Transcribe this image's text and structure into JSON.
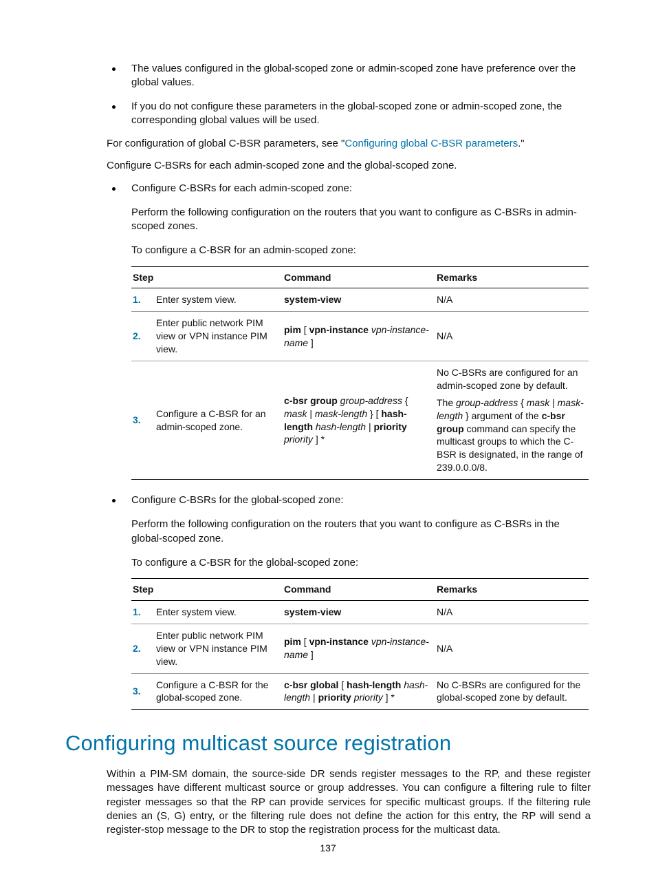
{
  "bullets_top": [
    "The values configured in the global-scoped zone or admin-scoped zone have preference over the global values.",
    "If you do not configure these parameters in the global-scoped zone or admin-scoped zone, the corresponding global values will be used."
  ],
  "para_global_cfg_pre": "For configuration of global C-BSR parameters, see \"",
  "para_global_cfg_link": "Configuring global C-BSR parameters",
  "para_global_cfg_post": ".\"",
  "para_configure_each": "Configure C-BSRs for each admin-scoped zone and the global-scoped zone.",
  "sub1_title": "Configure C-BSRs for each admin-scoped zone:",
  "sub1_perform": "Perform the following configuration on the routers that you want to configure as C-BSRs in admin-scoped zones.",
  "sub1_toconfig": "To configure a C-BSR for an admin-scoped zone:",
  "table_headers": {
    "step": "Step",
    "command": "Command",
    "remarks": "Remarks"
  },
  "table1": {
    "r1": {
      "num": "1.",
      "step": "Enter system view.",
      "cmd": "system-view",
      "rem": "N/A"
    },
    "r2": {
      "num": "2.",
      "step": "Enter public network PIM view or VPN instance PIM view.",
      "cmd_b1": "pim",
      "cmd_p1": " [ ",
      "cmd_b2": "vpn-instance",
      "cmd_p2": " ",
      "cmd_i1": "vpn-instance-name",
      "cmd_p3": " ]",
      "rem": "N/A"
    },
    "r3": {
      "num": "3.",
      "step": "Configure a C-BSR for an admin-scoped zone.",
      "cmd_b1": "c-bsr group",
      "cmd_sp1": " ",
      "cmd_i1": "group-address",
      "cmd_p1": " { ",
      "cmd_i2": "mask",
      "cmd_p2": " | ",
      "cmd_i3": "mask-length",
      "cmd_p3": " } [ ",
      "cmd_b2": "hash-length",
      "cmd_sp2": " ",
      "cmd_i4": "hash-length",
      "cmd_p4": " | ",
      "cmd_b3": "priority",
      "cmd_sp3": " ",
      "cmd_i5": "priority",
      "cmd_p5": " ] *",
      "rem_l1": "No C-BSRs are configured for an admin-scoped zone by default.",
      "rem_2a": "The ",
      "rem_2i1": "group-address",
      "rem_2b": " { ",
      "rem_2i2": "mask",
      "rem_2c": " | ",
      "rem_2i3": "mask-length",
      "rem_2d": " } argument of the ",
      "rem_2bold": "c-bsr group",
      "rem_2e": " command can specify the multicast groups to which the C-BSR is designated, in the range of 239.0.0.0/8."
    }
  },
  "sub2_title": "Configure C-BSRs for the global-scoped zone:",
  "sub2_perform": "Perform the following configuration on the routers that you want to configure as C-BSRs in the global-scoped zone.",
  "sub2_toconfig": "To configure a C-BSR for the global-scoped zone:",
  "table2": {
    "r1": {
      "num": "1.",
      "step": "Enter system view.",
      "cmd": "system-view",
      "rem": "N/A"
    },
    "r2": {
      "num": "2.",
      "step": "Enter public network PIM view or VPN instance PIM view.",
      "cmd_b1": "pim",
      "cmd_p1": " [ ",
      "cmd_b2": "vpn-instance",
      "cmd_p2": " ",
      "cmd_i1": "vpn-instance-name",
      "cmd_p3": " ]",
      "rem": "N/A"
    },
    "r3": {
      "num": "3.",
      "step": "Configure a C-BSR for the global-scoped zone.",
      "cmd_b1": "c-bsr global",
      "cmd_p1": " [ ",
      "cmd_b2": "hash-length",
      "cmd_sp1": " ",
      "cmd_i1": "hash-length",
      "cmd_p2": " | ",
      "cmd_b3": "priority",
      "cmd_sp2": " ",
      "cmd_i2": "priority",
      "cmd_p3": " ] *",
      "rem": "No C-BSRs are configured for the global-scoped zone by default."
    }
  },
  "section_heading": "Configuring multicast source registration",
  "section_body": "Within a PIM-SM domain, the source-side DR sends register messages to the RP, and these register messages have different multicast source or group addresses. You can configure a filtering rule to filter register messages so that the RP can provide services for specific multicast groups. If the filtering rule denies an (S, G) entry, or the filtering rule does not define the action for this entry, the RP will send a register-stop message to the DR to stop the registration process for the multicast data.",
  "page_number": "137"
}
